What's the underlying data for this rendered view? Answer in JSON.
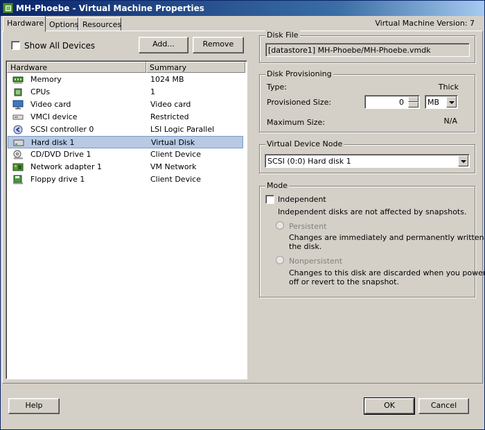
{
  "window": {
    "title": "MH-Phoebe - Virtual Machine Properties"
  },
  "tabs": [
    "Hardware",
    "Options",
    "Resources"
  ],
  "vm_version": "Virtual Machine Version: 7",
  "show_all_devices": {
    "label": "Show All Devices",
    "checked": false
  },
  "buttons": {
    "add": "Add...",
    "remove": "Remove",
    "help": "Help",
    "ok": "OK",
    "cancel": "Cancel"
  },
  "hardware_list": {
    "columns": [
      "Hardware",
      "Summary"
    ],
    "rows": [
      {
        "name": "Memory",
        "summary": "1024 MB",
        "icon": "memory-icon"
      },
      {
        "name": "CPUs",
        "summary": "1",
        "icon": "cpu-icon"
      },
      {
        "name": "Video card",
        "summary": "Video card",
        "icon": "monitor-icon"
      },
      {
        "name": "VMCI device",
        "summary": "Restricted",
        "icon": "device-icon"
      },
      {
        "name": "SCSI controller 0",
        "summary": "LSI Logic Parallel",
        "icon": "scsi-controller-icon"
      },
      {
        "name": "Hard disk 1",
        "summary": "Virtual Disk",
        "icon": "hard-disk-icon",
        "selected": true
      },
      {
        "name": "CD/DVD Drive 1",
        "summary": "Client Device",
        "icon": "cd-drive-icon"
      },
      {
        "name": "Network adapter 1",
        "summary": "VM Network",
        "icon": "network-adapter-icon"
      },
      {
        "name": "Floppy drive 1",
        "summary": "Client Device",
        "icon": "floppy-drive-icon"
      }
    ]
  },
  "disk_file": {
    "label": "Disk File",
    "value": "[datastore1] MH-Phoebe/MH-Phoebe.vmdk"
  },
  "disk_provisioning": {
    "label": "Disk Provisioning",
    "type_label": "Type:",
    "type_value": "Thick",
    "size_label": "Provisioned Size:",
    "size_value": "0",
    "unit_value": "MB",
    "max_label": "Maximum Size:",
    "max_value": "N/A"
  },
  "virtual_device_node": {
    "label": "Virtual Device Node",
    "value": "SCSI (0:0) Hard disk 1"
  },
  "mode": {
    "label": "Mode",
    "independent_label": "Independent",
    "independent_desc": "Independent disks are not affected by snapshots.",
    "persistent_label": "Persistent",
    "persistent_desc_1": "Changes are immediately and permanently written to",
    "persistent_desc_2": "the disk.",
    "nonpersistent_label": "Nonpersistent",
    "nonpersistent_desc_1": "Changes to this disk are discarded when you power",
    "nonpersistent_desc_2": "off or revert to the snapshot."
  },
  "colors": {
    "title_bar": "#0a246a",
    "selection": "#b7c9e3",
    "face": "#d4d0c8"
  }
}
